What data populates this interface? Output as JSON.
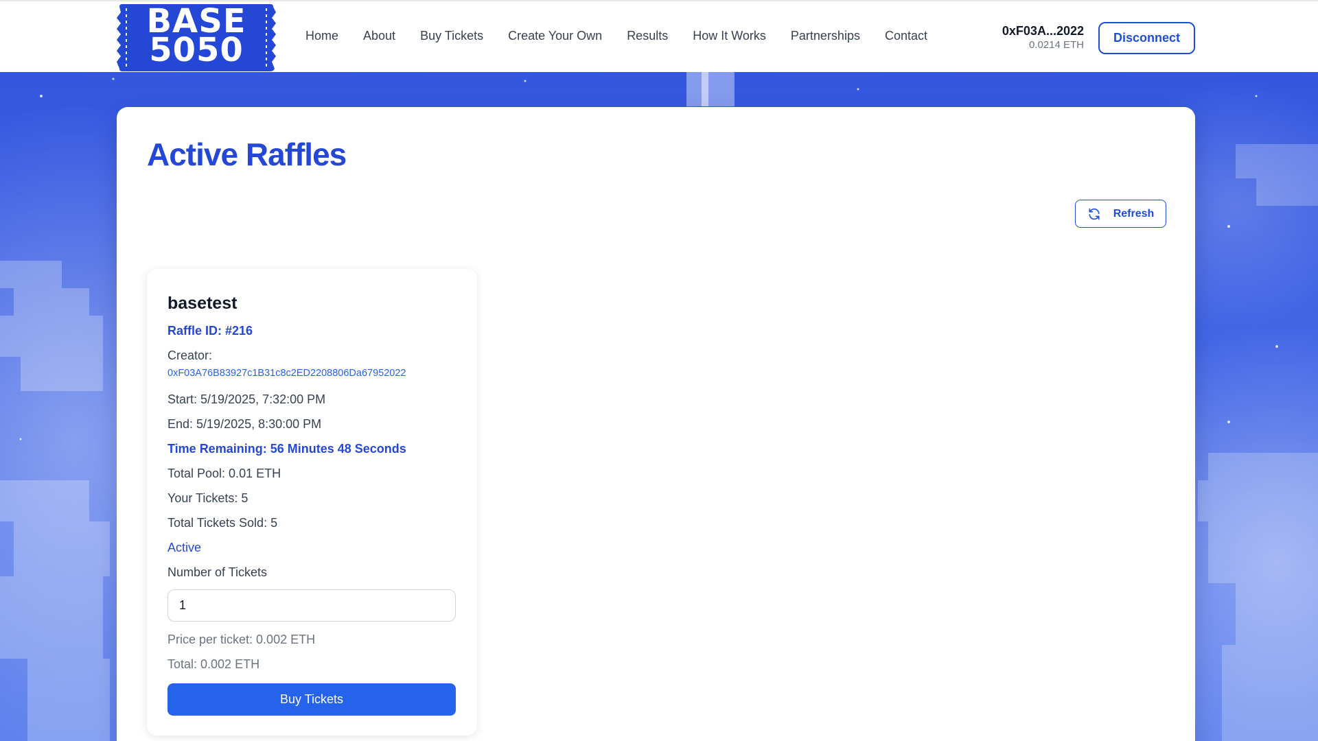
{
  "header": {
    "logo_line1": "BASE",
    "logo_line2": "5050",
    "nav": [
      {
        "label": "Home"
      },
      {
        "label": "About"
      },
      {
        "label": "Buy Tickets"
      },
      {
        "label": "Create Your Own"
      },
      {
        "label": "Results"
      },
      {
        "label": "How It Works"
      },
      {
        "label": "Partnerships"
      },
      {
        "label": "Contact"
      }
    ],
    "wallet_address": "0xF03A...2022",
    "wallet_balance": "0.0214 ETH",
    "disconnect_label": "Disconnect"
  },
  "main": {
    "title": "Active Raffles",
    "refresh_label": "Refresh"
  },
  "raffle": {
    "name": "basetest",
    "id_text": "Raffle ID: #216",
    "creator_label": "Creator:",
    "creator_address": "0xF03A76B83927c1B31c8c2ED2208806Da67952022",
    "start": "Start: 5/19/2025, 7:32:00 PM",
    "end": "End: 5/19/2025, 8:30:00 PM",
    "time_remaining": "Time Remaining: 56 Minutes 48 Seconds",
    "total_pool": "Total Pool: 0.01 ETH",
    "your_tickets": "Your Tickets: 5",
    "total_sold": "Total Tickets Sold: 5",
    "status": "Active",
    "tickets_label": "Number of Tickets",
    "tickets_value": "1",
    "price_per_ticket": "Price per ticket: 0.002 ETH",
    "total": "Total: 0.002 ETH",
    "buy_label": "Buy Tickets"
  },
  "colors": {
    "brand_blue": "#2447d6",
    "button_blue": "#2563eb",
    "background_blue": "#3a5fe0"
  },
  "icons": {
    "refresh": "refresh-icon"
  }
}
